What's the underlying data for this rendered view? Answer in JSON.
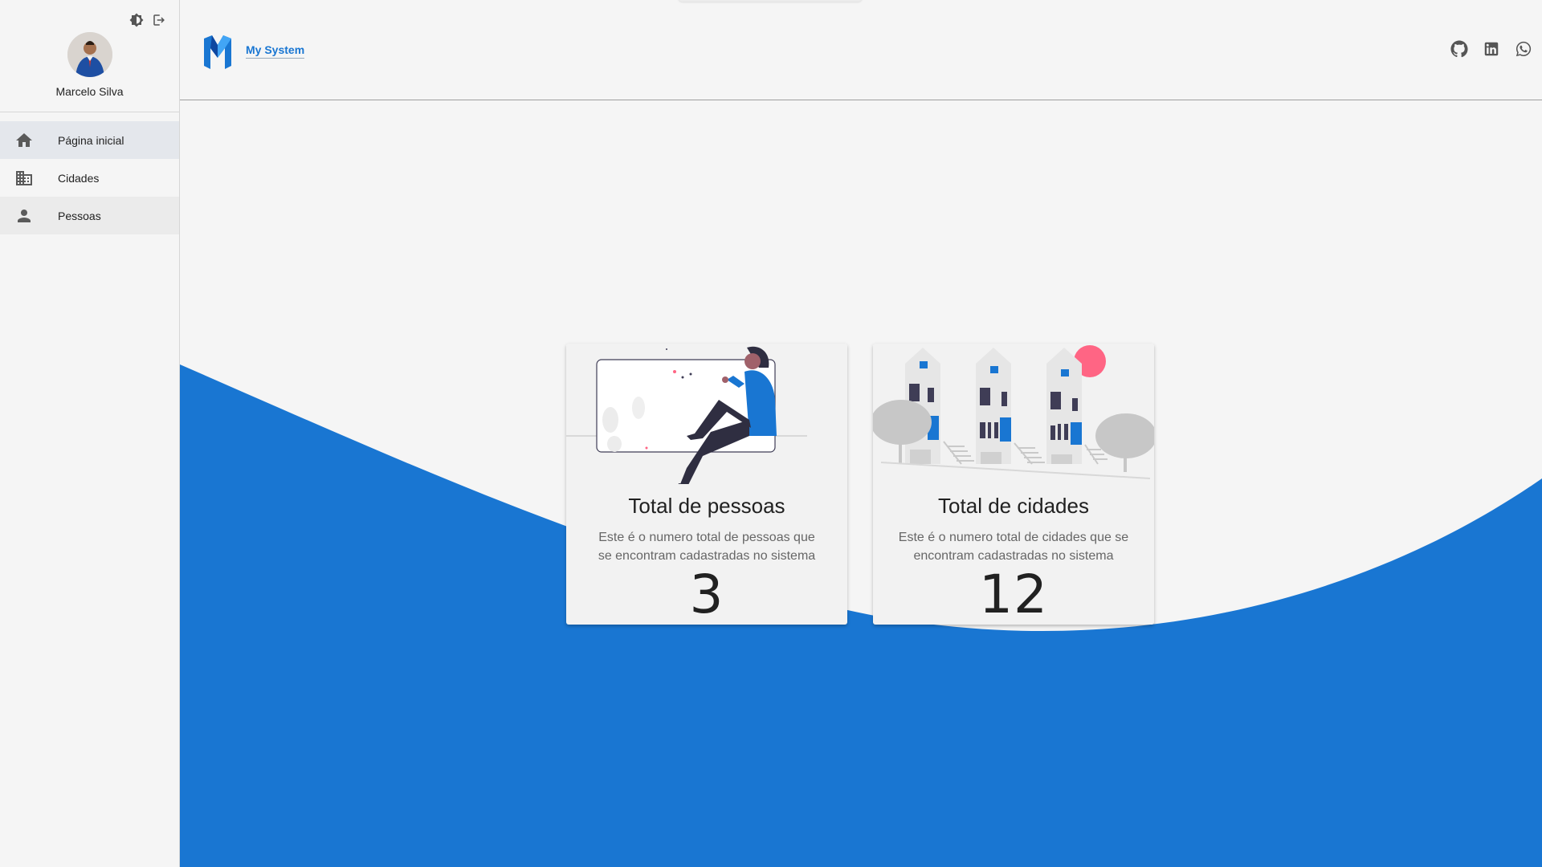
{
  "user": {
    "name": "Marcelo Silva"
  },
  "sidebar": {
    "items": [
      {
        "label": "Página inicial",
        "icon": "home-icon"
      },
      {
        "label": "Cidades",
        "icon": "city-icon"
      },
      {
        "label": "Pessoas",
        "icon": "person-icon"
      }
    ]
  },
  "header": {
    "brand": "My System",
    "social": [
      "github-icon",
      "linkedin-icon",
      "whatsapp-icon"
    ]
  },
  "cards": [
    {
      "title": "Total de pessoas",
      "description": "Este é o numero total de pessoas que se encontram cadastradas no sistema",
      "value": "3"
    },
    {
      "title": "Total de cidades",
      "description": "Este é o numero total de cidades que se encontram cadastradas no sistema",
      "value": "12"
    }
  ],
  "colors": {
    "primary": "#1976d2",
    "accent": "#ff6584",
    "background": "#f5f5f5"
  }
}
